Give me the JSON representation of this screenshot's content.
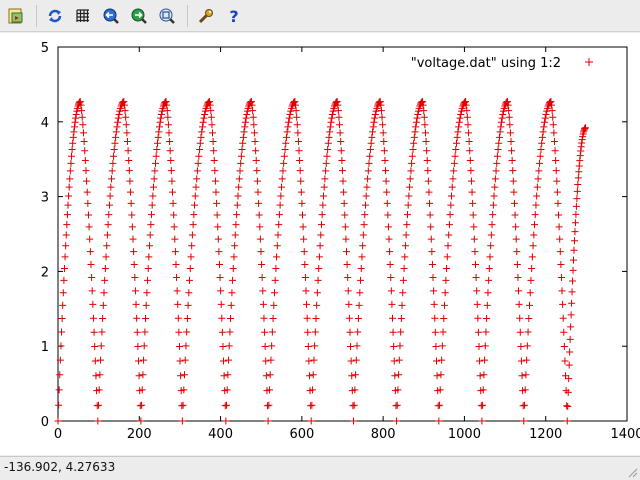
{
  "toolbar": {
    "buttons": [
      {
        "name": "export-icon"
      },
      {
        "name": "replot-icon"
      },
      {
        "name": "grid-icon"
      },
      {
        "name": "zoom-previous-icon"
      },
      {
        "name": "zoom-next-icon"
      },
      {
        "name": "autoscale-icon"
      },
      {
        "name": "options-icon"
      },
      {
        "name": "help-icon"
      }
    ]
  },
  "status": {
    "coordinates": "-136.902,  4.27633"
  },
  "colors": {
    "series": "#e00000",
    "axis": "#000000"
  },
  "chart_data": {
    "type": "scatter",
    "title": "",
    "xlabel": "",
    "ylabel": "",
    "xlim": [
      0,
      1400
    ],
    "ylim": [
      0,
      5
    ],
    "x_ticks": [
      "0",
      "200",
      "400",
      "600",
      "800",
      "1000",
      "1200",
      "1400"
    ],
    "y_ticks": [
      "0",
      "1",
      "2",
      "3",
      "4",
      "5"
    ],
    "legend_position": "top-right",
    "grid": false,
    "series": [
      {
        "name": "\"voltage.dat\" using 1:2",
        "marker": "+",
        "peak_x": [
          55,
          162,
          266,
          373,
          476,
          583,
          687,
          793,
          897,
          1003,
          1106,
          1213
        ],
        "peak_y": 4.27,
        "trough_x": [
          0,
          98,
          204,
          306,
          413,
          517,
          623,
          727,
          833,
          937,
          1043,
          1146,
          1253
        ],
        "trough_y": 0,
        "end_point": [
          1298,
          3.92
        ]
      }
    ]
  }
}
